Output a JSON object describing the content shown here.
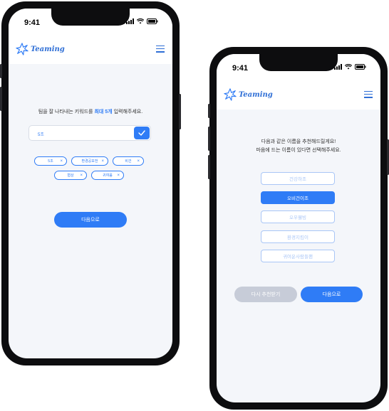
{
  "status": {
    "time": "9:41"
  },
  "app": {
    "logo_text": "Teaming",
    "accent": "#2f7cf6"
  },
  "screen1": {
    "prompt_before": "팀을 잘 나타내는 키워드를 ",
    "prompt_accent": "최대 5개",
    "prompt_after": " 입력해주세요.",
    "input_value": "5조",
    "chips": [
      "5조",
      "환경공모전",
      "비건",
      "협상",
      "귀여움"
    ],
    "chip_remove": "×",
    "next_label": "다음으로"
  },
  "screen2": {
    "prompt_line1": "다음과 같은 이름을 추천해드릴게요!",
    "prompt_line2": "마음에 드는 이름이 있다면 선택해주세요.",
    "options": [
      "건강하조",
      "오비건이조",
      "오우웰빙",
      "환경지킴이",
      "귀여운사람들팬"
    ],
    "selected_index": 1,
    "retry_label": "다시 추천받기",
    "next_label": "다음으로"
  }
}
